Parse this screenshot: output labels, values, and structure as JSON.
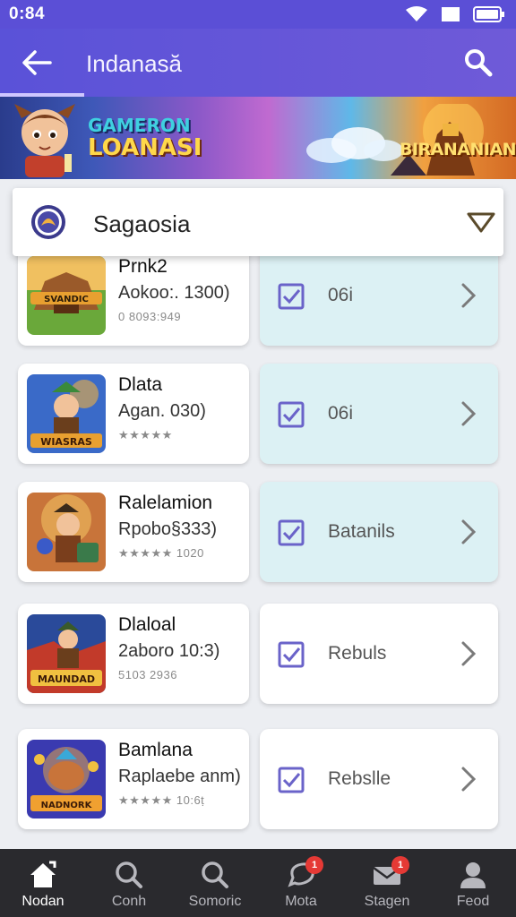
{
  "status_bar": {
    "time": "0:84"
  },
  "app_bar": {
    "title": "Indanasă"
  },
  "banner": {
    "left_line1": "GAMERON",
    "left_line2": "LOANASI",
    "right_text": "BIRANANIAN"
  },
  "dropdown": {
    "label": "Sagaosia"
  },
  "games": [
    {
      "name": "Prnk2",
      "sub": "Aokoo:. 1300)",
      "meta": "0 8093:949",
      "status": "06i",
      "tinted": true
    },
    {
      "name": "Dlata",
      "sub": "Agan. 030)",
      "meta": "★★★★★",
      "status": "06i",
      "tinted": true
    },
    {
      "name": "Ralelamion",
      "sub": "Rpobo§333)",
      "meta": "★★★★★ 1020",
      "status": "Batanils",
      "tinted": true
    },
    {
      "name": "Dlaloal",
      "sub": "2aboro 10:3)",
      "meta": "5103 2936",
      "status": "Rebuls",
      "tinted": false
    },
    {
      "name": "Bamlana",
      "sub": "Raplaebe anm)",
      "meta": "★★★★★ 10:6ṭ",
      "status": "Rebslle",
      "tinted": false
    }
  ],
  "bottom_nav": [
    {
      "label": "Nodan",
      "icon": "home-icon",
      "active": true,
      "badge": ""
    },
    {
      "label": "Conh",
      "icon": "search-icon",
      "active": false,
      "badge": ""
    },
    {
      "label": "Somoric",
      "icon": "search-icon",
      "active": false,
      "badge": ""
    },
    {
      "label": "Mota",
      "icon": "chat-icon",
      "active": false,
      "badge": "1"
    },
    {
      "label": "Stagen",
      "icon": "mail-icon",
      "active": false,
      "badge": "1"
    },
    {
      "label": "Feod",
      "icon": "person-icon",
      "active": false,
      "badge": ""
    }
  ],
  "colors": {
    "primary": "#5b4fd6",
    "tint_card": "#dcf1f4",
    "check": "#6a63c9",
    "nav_bg": "#2a2a2e",
    "badge": "#e53935"
  }
}
